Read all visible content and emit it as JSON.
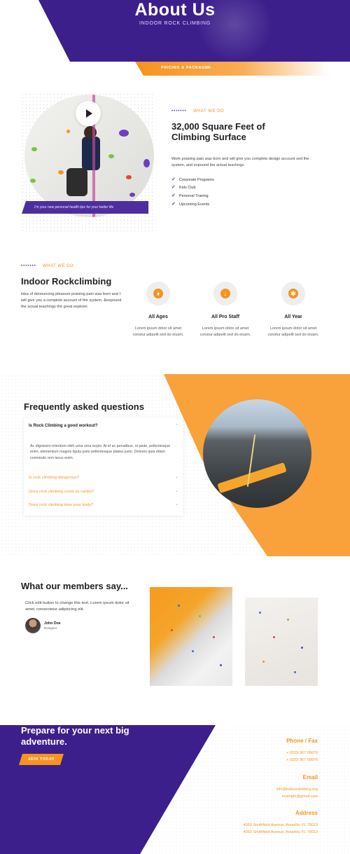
{
  "hero": {
    "title": "About Us",
    "subtitle": "INDOOR ROCK CLIMBING",
    "pricing_label": "PRICING & PACKAGES",
    "pricing_caret": "▾"
  },
  "intro": {
    "caption": "I'm your new personal health tips for your better life",
    "eyebrow_dots": "•••••••",
    "eyebrow": "WHAT WE DO",
    "heading": "32,000 Square Feet of Climbing Surface",
    "body": "Work praising pain was born and will give you complete design account sed the system, and expound the actual teachngs.",
    "list": [
      "Corporate Programs",
      "Kids Club",
      "Personal Traning",
      "Upcoming Events"
    ]
  },
  "features_section": {
    "eyebrow_dots": "•••••••",
    "eyebrow": "WHAT WE DO",
    "heading": "Indoor Rockclimbing",
    "body": "Idea of denouncing pleasure praising pain was born and I will give you a complete account of the system, &expound the actual teachings the great explorer.",
    "features": [
      {
        "icon": "person-icon",
        "glyph": "♦",
        "title": "All Ages",
        "desc": "Lorem ipsum dolor sit amet constur adipelit sed do eiusm."
      },
      {
        "icon": "sort-numbers-icon",
        "glyph": "↓",
        "title": "All Pro Staff",
        "desc": "Lorem ipsum dolor sit amet constur adipelit sed do eiusm."
      },
      {
        "icon": "snowflake-icon",
        "glyph": "✻",
        "title": "All Year",
        "desc": "Lorem ipsum dolor sit amet constur adipelit sed do eiusm."
      }
    ]
  },
  "faq": {
    "title": "Frequently asked questions",
    "open_question": "Is Rock Climbing a good workout?",
    "open_answer": "Ac dignissim interdum nibh urna urna turpis. At id ac penatibus, ut pede, pellentesque enim, elementum magnis ligula justo pellentesque platea justo. Dolores quia etiam commodo rem lacus enim.",
    "questions": [
      "Is rock climbing dangerous?",
      "Does rock climbing count as cardio?",
      "Does rock climbing tone your body?"
    ],
    "chevron": "⌄"
  },
  "testimonials": {
    "title": "What our members say...",
    "text": "Click edit button to change this text. Lorem ipsum dolor sit amet, consectetur adipiscing elit.",
    "author_name": "John Doe",
    "author_role": "Designer"
  },
  "footer": {
    "cta_title": "Prepare for your next big adventure.",
    "cta_button": "JOIN TODAY",
    "phone_heading": "Phone / Fax",
    "phones": [
      "+ (020) 367 09876",
      "+ (020) 367 09876"
    ],
    "email_heading": "Email",
    "emails": [
      "info@indoorclimbing.org",
      "example@gmail.com"
    ],
    "address_heading": "Address",
    "addresses": [
      "4050 Smithfield Avenue, Amarillo, FL 79013",
      "4050 Smithfield Avenue, Amarillo, FL 79013"
    ]
  },
  "colors": {
    "purple": "#3d1f8c",
    "orange": "#f7931e"
  }
}
